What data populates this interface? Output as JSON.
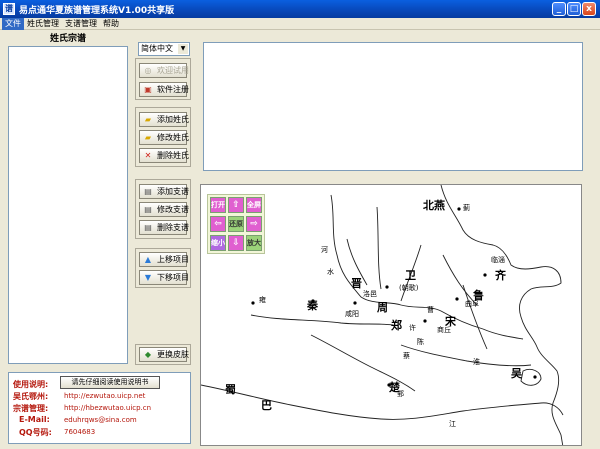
{
  "window": {
    "title": "易点通华夏族谱管理系统V1.00共享版",
    "icon_text": "谱",
    "buttons": [
      "_",
      "□",
      "x"
    ]
  },
  "menu": [
    "文件",
    "姓氏管理",
    "支谱管理",
    "帮助"
  ],
  "left_panel": {
    "title": "姓氏宗谱"
  },
  "language": {
    "selected": "简体中文"
  },
  "buttons": {
    "welcome": "欢迎试用",
    "register": "软件注册",
    "add_surname": "添加姓氏",
    "edit_surname": "修改姓氏",
    "delete_surname": "删除姓氏",
    "add_branch": "添加支谱",
    "edit_branch": "修改支谱",
    "delete_branch": "删除支谱",
    "move_up": "上移项目",
    "move_down": "下移项目",
    "change_skin": "更换皮肤",
    "manual": "请先仔细阅读使用说明书"
  },
  "map_nav": {
    "open": "打开",
    "up": "⇧",
    "fullscreen": "全屏",
    "left": "⇦",
    "reset": "还原",
    "right": "⇨",
    "zoom_out": "缩小",
    "down": "⇩",
    "zoom_in": "放大"
  },
  "info": {
    "usage_label": "使用说明:",
    "e_label": "吴氏鄂州:",
    "e_value": "http://ezwutao.uicp.net",
    "hb_label": "宗谱管理:",
    "hb_value": "http://hbezwutao.uicp.cn",
    "email_label": "E-Mail:",
    "email_value": "eduhrqws@sina.com",
    "qq_label": "QQ号码:",
    "qq_value": "7604683"
  },
  "map_labels": {
    "beiyan": "北燕",
    "ji": "蓟",
    "qi": "齐",
    "jin": "晋",
    "wei": "卫",
    "qin": "秦",
    "zhou": "周",
    "zheng": "郑",
    "song": "宋",
    "lu": "鲁",
    "chu": "楚",
    "wu": "吴",
    "shu": "蜀",
    "ba": "巴",
    "xianyang": "咸阳",
    "luoyi": "洛邑",
    "chaoge": "(朝歌)",
    "linzi": "临淄",
    "qufu": "曲阜",
    "shangqiu": "商丘",
    "ying": "郢",
    "yong": "雍",
    "ha": "河",
    "shui": "水",
    "jiang": "江",
    "he2": "淮",
    "cao": "曹",
    "chen": "陈",
    "cai": "蔡",
    "xu": "许"
  }
}
